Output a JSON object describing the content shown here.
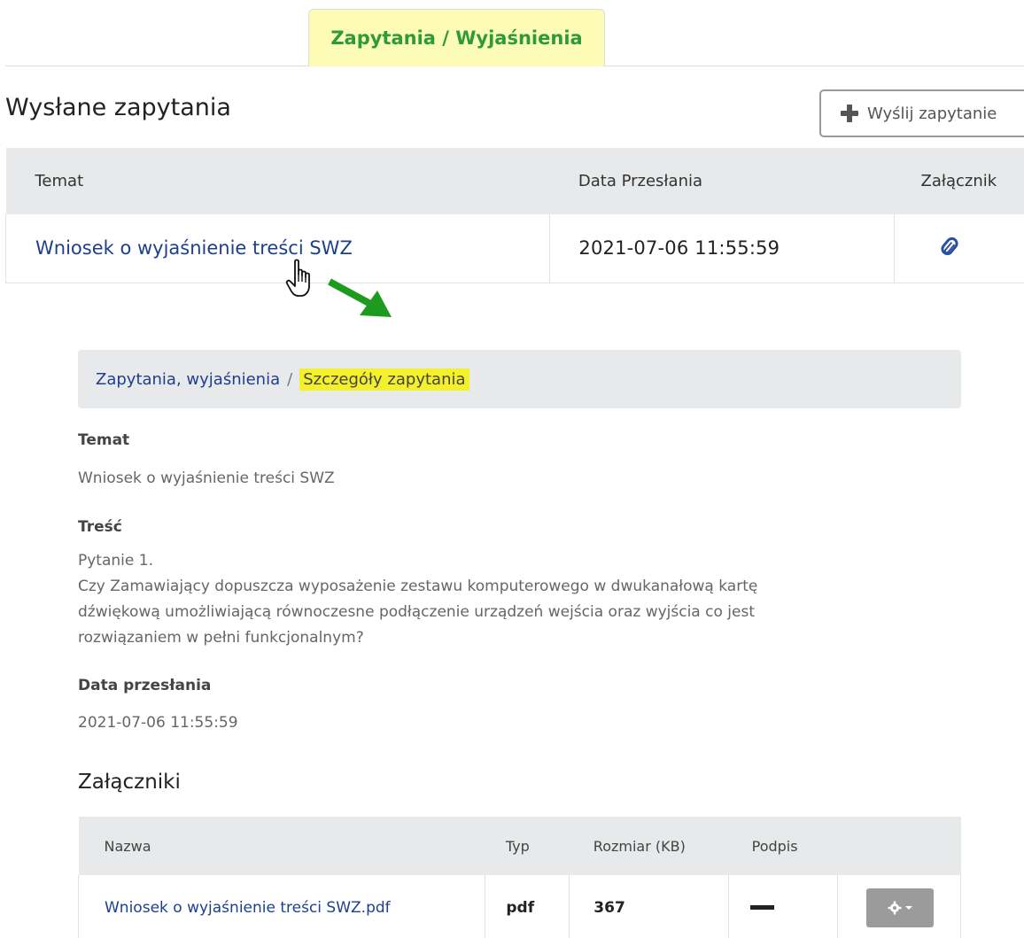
{
  "tabs": [
    {
      "label": "Zapytania / Wyjaśnienia",
      "active": true
    }
  ],
  "section": {
    "title": "Wysłane zapytania",
    "send_button": "Wyślij zapytanie"
  },
  "top_table": {
    "headers": {
      "subject": "Temat",
      "date": "Data Przesłania",
      "attachment": "Załącznik"
    },
    "rows": [
      {
        "subject": "Wniosek o wyjaśnienie treści SWZ",
        "date": "2021-07-06 11:55:59",
        "attachment_icon": "paperclip-icon"
      }
    ]
  },
  "breadcrumb": {
    "parent": "Zapytania, wyjaśnienia",
    "separator": "/",
    "current": "Szczegóły zapytania",
    "highlight_color": "#f4f02c"
  },
  "detail": {
    "subject_label": "Temat",
    "subject_value": "Wniosek o wyjaśnienie treści SWZ",
    "content_label": "Treść",
    "content_line1": "Pytanie 1.",
    "content_line2": "Czy Zamawiający dopuszcza wyposażenie zestawu komputerowego w dwukanałową kartę",
    "content_line3": "dźwiękową umożliwiającą równoczesne podłączenie urządzeń wejścia oraz wyjścia co jest",
    "content_line4": "rozwiązaniem w pełni funkcjonalnym?",
    "date_label": "Data przesłania",
    "date_value": "2021-07-06 11:55:59"
  },
  "attachments": {
    "title": "Załączniki",
    "headers": {
      "name": "Nazwa",
      "type": "Typ",
      "size": "Rozmiar (KB)",
      "signature": "Podpis"
    },
    "rows": [
      {
        "name": "Wniosek o wyjaśnienie treści SWZ.pdf",
        "type": "pdf",
        "size": "367",
        "signature_icon": "dash-icon",
        "actions_icon": "gear-icon"
      }
    ]
  },
  "colors": {
    "tab_bg": "#fdfcb6",
    "tab_text": "#2e9a3a",
    "link": "#1d3f8f",
    "arrow": "#1e9a1e",
    "header_bg": "#e7e9ea"
  }
}
